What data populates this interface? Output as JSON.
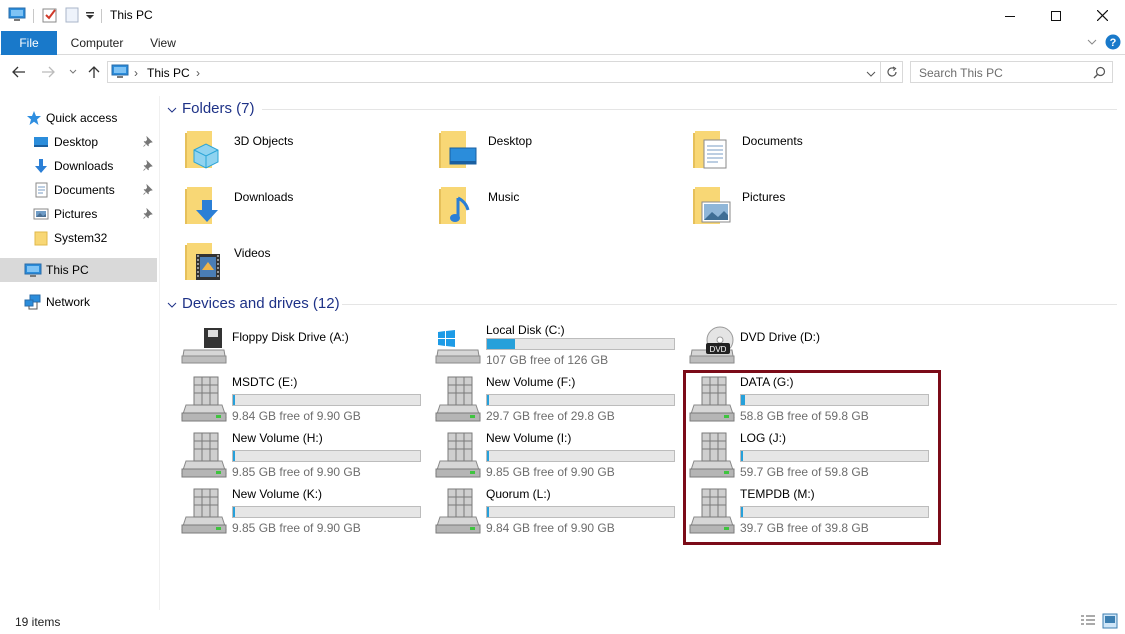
{
  "window": {
    "title": "This PC",
    "controls": [
      "minimize-icon",
      "maximize-icon",
      "close-icon"
    ]
  },
  "ribbon": {
    "tabs": [
      "File",
      "Computer",
      "View"
    ]
  },
  "address": {
    "path": [
      "This PC"
    ],
    "search_placeholder": "Search This PC"
  },
  "sidebar": {
    "quick_access": "Quick access",
    "quick_items": [
      {
        "label": "Desktop",
        "icon": "desktop-icon",
        "pinned": true
      },
      {
        "label": "Downloads",
        "icon": "downloads-icon",
        "pinned": true
      },
      {
        "label": "Documents",
        "icon": "documents-icon",
        "pinned": true
      },
      {
        "label": "Pictures",
        "icon": "pictures-icon",
        "pinned": true
      },
      {
        "label": "System32",
        "icon": "folder-icon",
        "pinned": false
      }
    ],
    "this_pc": "This PC",
    "network": "Network"
  },
  "folders": {
    "heading": "Folders (7)",
    "items": [
      "3D Objects",
      "Desktop",
      "Documents",
      "Downloads",
      "Music",
      "Pictures",
      "Videos"
    ]
  },
  "drives": {
    "heading": "Devices and drives (12)",
    "items": [
      {
        "name": "Floppy Disk Drive (A:)",
        "type": "floppy",
        "free_text": "",
        "used_fraction": null
      },
      {
        "name": "Local Disk (C:)",
        "type": "system",
        "free_text": "107 GB free of 126 GB",
        "used_fraction": 0.15
      },
      {
        "name": "DVD Drive (D:)",
        "type": "dvd",
        "free_text": "",
        "used_fraction": null
      },
      {
        "name": "MSDTC (E:)",
        "type": "disk",
        "free_text": "9.84 GB free of 9.90 GB",
        "used_fraction": 0.01
      },
      {
        "name": "New Volume (F:)",
        "type": "disk",
        "free_text": "29.7 GB free of 29.8 GB",
        "used_fraction": 0.01
      },
      {
        "name": "DATA (G:)",
        "type": "disk",
        "free_text": "58.8 GB free of 59.8 GB",
        "used_fraction": 0.02
      },
      {
        "name": "New Volume (H:)",
        "type": "disk",
        "free_text": "9.85 GB free of 9.90 GB",
        "used_fraction": 0.01
      },
      {
        "name": "New Volume (I:)",
        "type": "disk",
        "free_text": "9.85 GB free of 9.90 GB",
        "used_fraction": 0.01
      },
      {
        "name": "LOG (J:)",
        "type": "disk",
        "free_text": "59.7 GB free of 59.8 GB",
        "used_fraction": 0.002
      },
      {
        "name": "New Volume (K:)",
        "type": "disk",
        "free_text": "9.85 GB free of 9.90 GB",
        "used_fraction": 0.01
      },
      {
        "name": "Quorum (L:)",
        "type": "disk",
        "free_text": "9.84 GB free of 9.90 GB",
        "used_fraction": 0.01
      },
      {
        "name": "TEMPDB (M:)",
        "type": "disk",
        "free_text": "39.7 GB free of 39.8 GB",
        "used_fraction": 0.003
      }
    ]
  },
  "status": {
    "count": "19 items"
  },
  "colors": {
    "accent": "#1979ca",
    "bar_fill": "#26a0da",
    "highlight_border": "#7b0b18",
    "heading": "#1e3287"
  }
}
